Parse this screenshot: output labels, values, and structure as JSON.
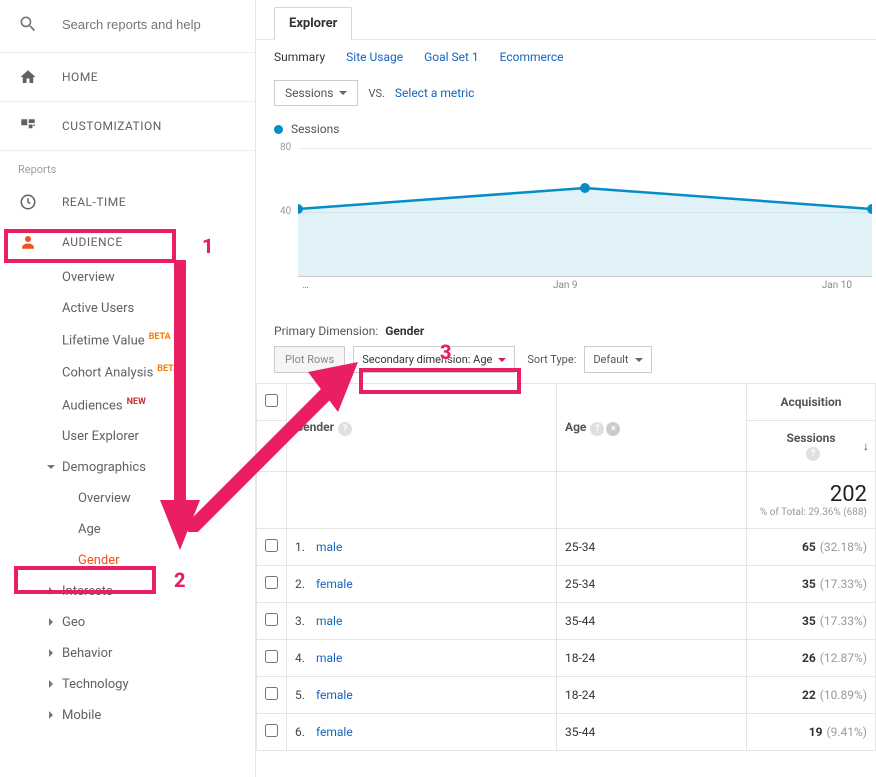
{
  "search": {
    "placeholder": "Search reports and help"
  },
  "nav": {
    "home": "HOME",
    "custom": "CUSTOMIZATION",
    "reports_header": "Reports",
    "realtime": "REAL-TIME",
    "audience": "AUDIENCE"
  },
  "audience_sub": {
    "overview": "Overview",
    "active": "Active Users",
    "lifetime": "Lifetime Value",
    "lifetime_badge": "BETA",
    "cohort": "Cohort Analysis",
    "cohort_badge": "BETA",
    "audiences": "Audiences",
    "audiences_badge": "NEW",
    "user_explorer": "User Explorer",
    "demographics": "Demographics",
    "demo_overview": "Overview",
    "age": "Age",
    "gender": "Gender",
    "interests": "Interests",
    "geo": "Geo",
    "behavior": "Behavior",
    "technology": "Technology",
    "mobile": "Mobile"
  },
  "tabs": {
    "explorer": "Explorer"
  },
  "subtabs": {
    "summary": "Summary",
    "site_usage": "Site Usage",
    "goal1": "Goal Set 1",
    "ecom": "Ecommerce"
  },
  "metric": {
    "sessions": "Sessions",
    "vs": "VS.",
    "select": "Select a metric"
  },
  "legend": {
    "label": "Sessions"
  },
  "chart": {
    "ylabel_top": "80",
    "ylabel_mid": "40",
    "x0": "…",
    "x1": "Jan 9",
    "x2": "Jan 10"
  },
  "chart_data": {
    "type": "line",
    "title": "",
    "ylabel": "Sessions",
    "ylim": [
      0,
      80
    ],
    "yticks": [
      40,
      80
    ],
    "categories": [
      "…",
      "Jan 9",
      "Jan 10"
    ],
    "series": [
      {
        "name": "Sessions",
        "values": [
          42,
          55,
          42
        ]
      }
    ]
  },
  "pd": {
    "label": "Primary Dimension:",
    "value": "Gender"
  },
  "ctrl": {
    "plot": "Plot Rows",
    "secondary": "Secondary dimension: Age",
    "sort_label": "Sort Type:",
    "sort_value": "Default"
  },
  "table": {
    "col_gender": "Gender",
    "col_age": "Age",
    "col_acq": "Acquisition",
    "col_sessions": "Sessions",
    "total_sessions": "202",
    "total_pct": "% of Total: 29.36% (688)",
    "rows": [
      {
        "i": "1.",
        "g": "male",
        "a": "25-34",
        "s": "65",
        "p": "(32.18%)"
      },
      {
        "i": "2.",
        "g": "female",
        "a": "25-34",
        "s": "35",
        "p": "(17.33%)"
      },
      {
        "i": "3.",
        "g": "male",
        "a": "35-44",
        "s": "35",
        "p": "(17.33%)"
      },
      {
        "i": "4.",
        "g": "male",
        "a": "18-24",
        "s": "26",
        "p": "(12.87%)"
      },
      {
        "i": "5.",
        "g": "female",
        "a": "18-24",
        "s": "22",
        "p": "(10.89%)"
      },
      {
        "i": "6.",
        "g": "female",
        "a": "35-44",
        "s": "19",
        "p": "(9.41%)"
      }
    ]
  },
  "annotations": {
    "n1": "1",
    "n2": "2",
    "n3": "3"
  }
}
